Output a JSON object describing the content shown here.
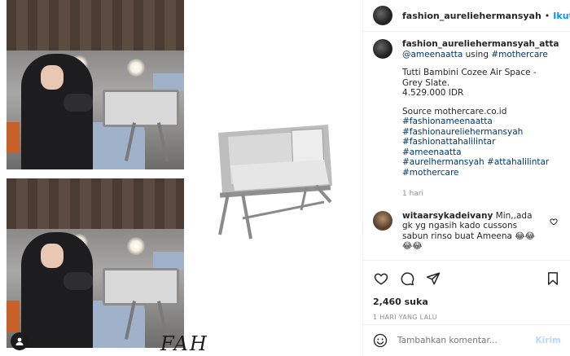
{
  "header": {
    "username": "fashion_aureliehermansyah",
    "separator": "•",
    "follow_label": "Ikuti"
  },
  "caption": {
    "username": "fashion_aureliehermansyah_atta",
    "mention": "@ameenaatta",
    "using_text": " using ",
    "hashtag_brand": "#mothercare",
    "product": "Tutti Bambini Cozee Air Space - Grey Slate.",
    "price": "4.529.000 IDR",
    "source": "Source mothercare.co.id",
    "hashtags": [
      "#fashionameenaatta",
      "#fashionaureliehermansyah",
      "#fashionattahalilintar",
      "#ameenaatta",
      "#aurelhermansyah",
      "#attahalilintar",
      "#mothercare"
    ],
    "time": "1 hari"
  },
  "comment": {
    "username": "witaarsykadeivany",
    "text": " Min,,ada gk yg ngasih kado cussons sabun rinso buat Ameena 😂😂😂😂"
  },
  "actions": {
    "icons": [
      "heart-icon",
      "comment-icon",
      "share-icon",
      "bookmark-icon"
    ]
  },
  "likes": "2,460 suka",
  "post_time": "1 HARI YANG LALU",
  "add_comment": {
    "placeholder": "Tambahkan komentar...",
    "post_label": "Kirim"
  },
  "media": {
    "watermark": "FAH"
  },
  "colors": {
    "link": "#00376b",
    "follow": "#0095f6",
    "post_disabled": "#b3dbff"
  }
}
